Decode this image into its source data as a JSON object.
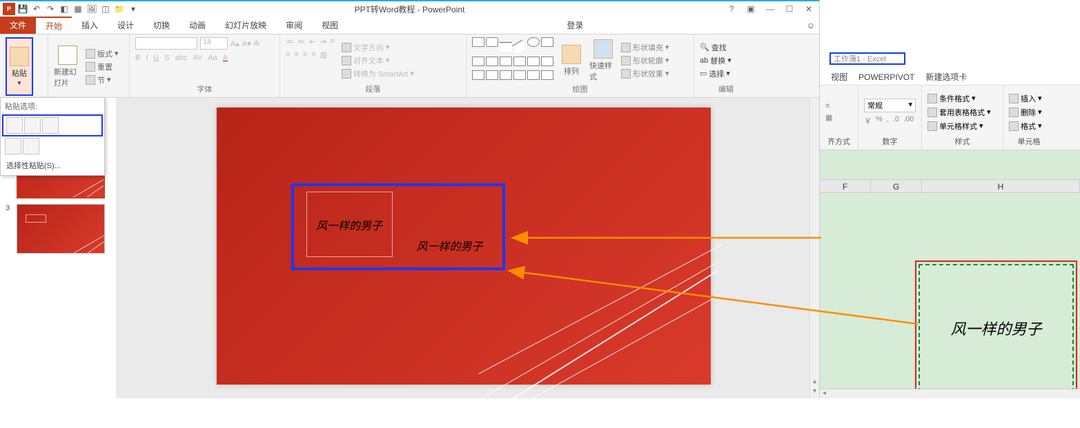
{
  "app_title": "PPT转Word教程 - PowerPoint",
  "signin": "登录",
  "tabs": {
    "file": "文件",
    "home": "开始",
    "insert": "插入",
    "design": "设计",
    "transitions": "切换",
    "animations": "动画",
    "slideshow": "幻灯片放映",
    "review": "审阅",
    "view": "视图"
  },
  "ribbon": {
    "paste": "粘贴",
    "new_slide": "新建幻灯片",
    "layout": "版式",
    "reset": "重置",
    "section": "节",
    "font_group": "字体",
    "paragraph_group": "段落",
    "text_dir": "文字方向",
    "align_text": "对齐文本",
    "convert_smartart": "转换为 SmartArt",
    "drawing_group": "绘图",
    "arrange": "排列",
    "quick_styles": "快速样式",
    "shape_fill": "形状填充",
    "shape_outline": "形状轮廓",
    "shape_effects": "形状效果",
    "editing_group": "编辑",
    "find": "查找",
    "replace": "替换",
    "select": "选择",
    "font_size": "18"
  },
  "paste_menu": {
    "header": "粘贴选项:",
    "special": "选择性粘贴(S)..."
  },
  "slide_text_1": "风一样的男子",
  "slide_text_2": "风一样的男子",
  "excel": {
    "title": "工作簿1 - Excel",
    "tabs": {
      "view": "视图",
      "powerpivot": "POWERPIVOT",
      "new_tab": "新建选项卡"
    },
    "align_group": "齐方式",
    "number_group": "数字",
    "styles_group": "样式",
    "cells_group": "单元格",
    "number_format": "常规",
    "cond_fmt": "条件格式",
    "table_fmt": "套用表格格式",
    "cell_style": "单元格样式",
    "insert": "插入",
    "delete": "删除",
    "format": "格式",
    "cols": [
      "F",
      "G",
      "H"
    ],
    "cell_text": "风一样的男子"
  }
}
